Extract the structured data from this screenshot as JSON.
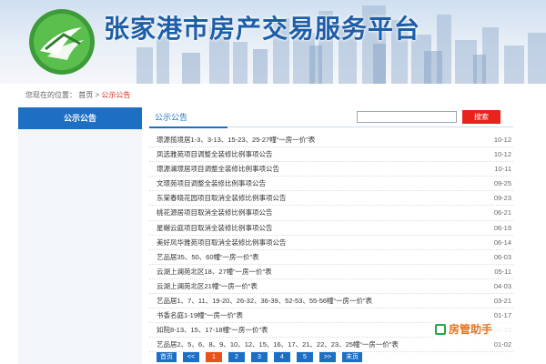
{
  "site": {
    "title": "张家港市房产交易服务平台"
  },
  "breadcrumb": {
    "prefix": "您现在的位置：",
    "home": "首页",
    "separator": ">",
    "current": "公示公告"
  },
  "sidebar": {
    "heading": "公示公告"
  },
  "main": {
    "tab_title": "公示公告",
    "search": {
      "value": "",
      "placeholder": "",
      "button_label": "搜索"
    },
    "items": [
      {
        "title": "璟源揽境居1-3、3-13、15-23、25-27幢“一房一价”表",
        "date": "10-12"
      },
      {
        "title": "凤选雅苑项目调整全装修比例事项公告",
        "date": "10-12"
      },
      {
        "title": "璟源澜璟居项目调整全装修比例事项公告",
        "date": "10-11"
      },
      {
        "title": "文璟苑项目调整全装修比例事项公告",
        "date": "09-25"
      },
      {
        "title": "东棠春晓花园项目取消全装修比例事项公告",
        "date": "09-23"
      },
      {
        "title": "桃花源居项目取消全装修比例事项公告",
        "date": "06-21"
      },
      {
        "title": "星樾云庭项目取消全装修比例事项公告",
        "date": "06-19"
      },
      {
        "title": "美好风华雅苑项目取消全装修比例事项公告",
        "date": "06-14"
      },
      {
        "title": "艺品居35、50、60幢“一房一价”表",
        "date": "06-03"
      },
      {
        "title": "云湖上澜苑北区18、27幢“一房一价”表",
        "date": "05-11"
      },
      {
        "title": "云湖上澜苑北区21幢“一房一价”表",
        "date": "04-03"
      },
      {
        "title": "艺品居1、7、11、19-20、26-32、36-39、52-53、55-56幢“一房一价”表",
        "date": "03-21"
      },
      {
        "title": "书香名庭1-19幢“一房一价”表",
        "date": "01-17"
      },
      {
        "title": "如院8-13、15、17-18幢“一房一价”表",
        "date": "01-15"
      },
      {
        "title": "艺品居2、5、6、8、9、10、12、15、16、17、21、22、23、25幢“一房一价”表",
        "date": "01-02"
      }
    ]
  },
  "pagination": {
    "first": "首页",
    "prev": "<<",
    "pages": [
      "1",
      "2",
      "3",
      "4",
      "5"
    ],
    "current": "1",
    "next": ">>",
    "last": "末页"
  },
  "watermark": {
    "text": "房管助手",
    "icon": "app-logo-icon"
  },
  "colors": {
    "brand_blue": "#1d6fc4",
    "title_blue": "#1e5ea8",
    "accent_red": "#e8231b",
    "active_page": "#e8531b"
  }
}
